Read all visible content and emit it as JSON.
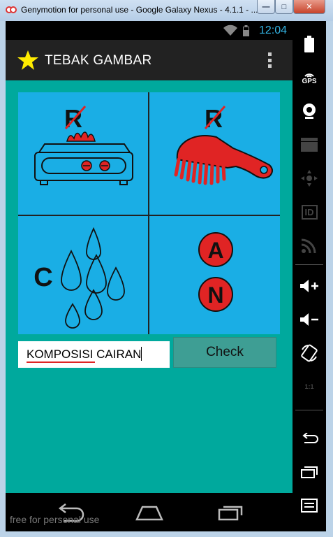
{
  "window": {
    "title": "Genymotion for personal use - Google Galaxy Nexus - 4.1.1 - ...",
    "minimize_label": "—",
    "maximize_label": "□",
    "close_label": "✕"
  },
  "status_bar": {
    "time": "12:04"
  },
  "action_bar": {
    "title": "TEBAK GAMBAR",
    "icon": "star-icon"
  },
  "puzzle": {
    "cells": [
      {
        "letter": "R",
        "icon": "stove-icon"
      },
      {
        "letter": "R",
        "icon": "comb-icon"
      },
      {
        "letter": "C",
        "icon": "water-drops-icon"
      },
      {
        "circles": [
          "A",
          "N"
        ]
      }
    ]
  },
  "answer": {
    "value": "KOMPOSISI CAIRAN",
    "misspelled_word": "KOMPOSISI"
  },
  "check_button": {
    "label": "Check"
  },
  "nav_bar": {
    "watermark": "free for personal use"
  },
  "side_panel": {
    "gps_label": "GPS",
    "id_label": "ID",
    "rotate_label": "1:1"
  },
  "colors": {
    "content_bg": "#00a99d",
    "puzzle_bg": "#1aaee5",
    "accent_red": "#e02424",
    "status_blue": "#33b5e5",
    "button_bg": "#3e9e94"
  }
}
